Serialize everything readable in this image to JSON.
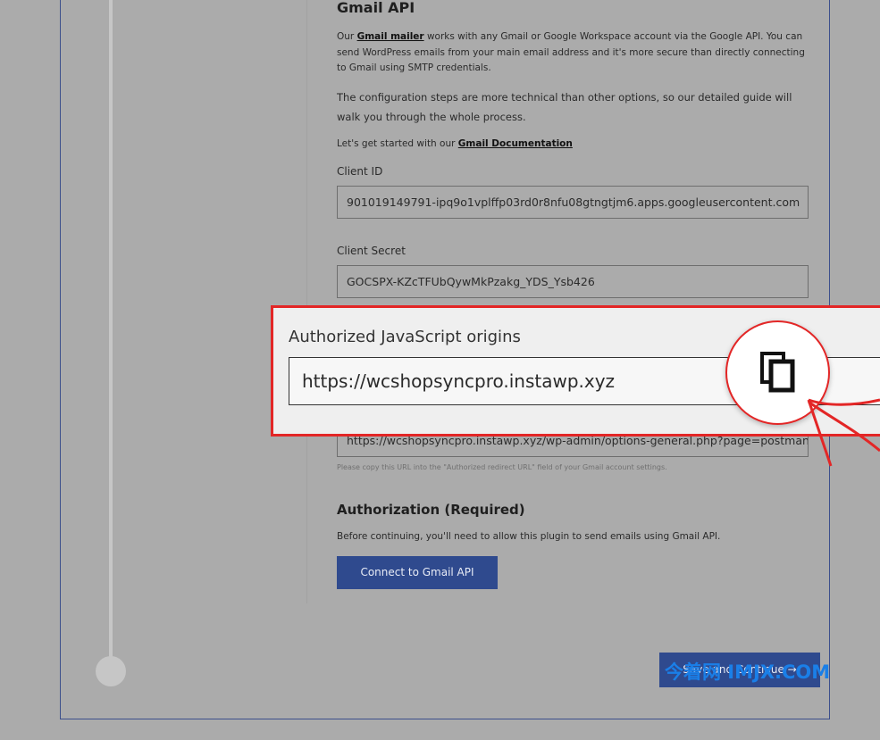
{
  "gmail": {
    "title": "Gmail API",
    "p1_before": "Our ",
    "p1_link": "Gmail mailer",
    "p1_after": " works with any Gmail or Google Workspace account via the Google API. You can send WordPress emails from your main email address and it's more secure than directly connecting to Gmail using SMTP credentials.",
    "p2": "The configuration steps are more technical than other options, so our detailed guide will walk you through the whole process.",
    "p3_before": "Let's get started with our ",
    "p3_link": "Gmail Documentation"
  },
  "fields": {
    "client_id_label": "Client ID",
    "client_id_value": "901019149791-ipq9o1vplffp03rd0r8nfu08gtngtjm6.apps.googleusercontent.com",
    "client_secret_label": "Client Secret",
    "client_secret_value": "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",
    "redirect_value": "https://wcshopsyncpro.instawp.xyz/wp-admin/options-general.php?page=postman",
    "redirect_hint": "Please copy this URL into the \"Authorized redirect URL\" field of your Gmail account settings."
  },
  "callout": {
    "label": "Authorized JavaScript origins",
    "value": "https://wcshopsyncpro.instawp.xyz",
    "icon": "copy-icon",
    "border_color": "#e32626"
  },
  "authorization": {
    "title": "Authorization (Required)",
    "text": "Before continuing, you'll need to allow this plugin to send emails using Gmail API.",
    "connect_label": "Connect to Gmail API"
  },
  "footer": {
    "save_label": "Save and Continue →",
    "watermark": "今着网 IMJX.COM"
  },
  "colors": {
    "accent": "#2f4a8e",
    "callout_red": "#e32626",
    "watermark": "#1a7fe8"
  }
}
